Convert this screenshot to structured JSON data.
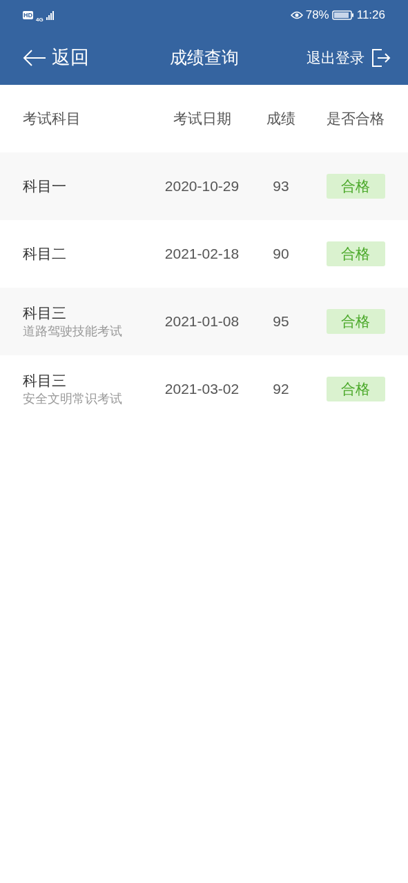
{
  "status_bar": {
    "hd": "HD",
    "network": "4G",
    "battery": "78%",
    "time": "11:26"
  },
  "header": {
    "back": "返回",
    "title": "成绩查询",
    "logout": "退出登录"
  },
  "table": {
    "columns": [
      "考试科目",
      "考试日期",
      "成绩",
      "是否合格"
    ],
    "rows": [
      {
        "subject": "科目一",
        "date": "2020-10-29",
        "score": "93",
        "result": "合格"
      },
      {
        "subject": "科目二",
        "date": "2021-02-18",
        "score": "90",
        "result": "合格"
      },
      {
        "subject": "科目三",
        "subtitle": "道路驾驶技能考试",
        "date": "2021-01-08",
        "score": "95",
        "result": "合格"
      },
      {
        "subject": "科目三",
        "subtitle": "安全文明常识考试",
        "date": "2021-03-02",
        "score": "92",
        "result": "合格"
      }
    ]
  }
}
